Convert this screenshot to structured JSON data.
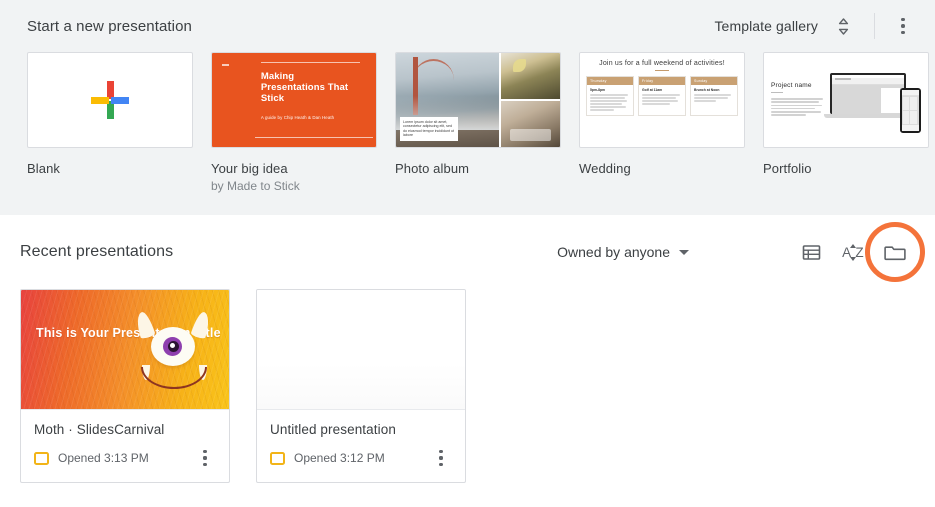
{
  "new_presentation": {
    "title": "Start a new presentation",
    "template_gallery_label": "Template gallery",
    "toggle_icon": "chevron-up-down-icon",
    "more_icon": "more-vert-icon",
    "templates": [
      {
        "label": "Blank",
        "sublabel": "",
        "thumb_kind": "blank-plus",
        "icon": "google-plus-icon"
      },
      {
        "label": "Your big idea",
        "sublabel": "by Made to Stick",
        "thumb_kind": "big-idea",
        "slide_title": "Making Presentations That Stick",
        "slide_byline": "A guide by Chip Heath & Dan Heath",
        "accent_color": "#e8541f"
      },
      {
        "label": "Photo album",
        "sublabel": "",
        "thumb_kind": "photo-album",
        "caption": "Lorem ipsum dolor sit amet, consectetur adipiscing elit, sed do eiusmod tempor incididunt ut labore"
      },
      {
        "label": "Wedding",
        "sublabel": "",
        "thumb_kind": "wedding",
        "slide_title": "Join us for a full weekend of activities!",
        "columns": [
          {
            "day": "Thursday",
            "heading": "5pm-8pm"
          },
          {
            "day": "Friday",
            "heading": "Golf at 11am"
          },
          {
            "day": "Sunday",
            "heading": "Brunch at Noon"
          }
        ],
        "accent_color": "#c9a173"
      },
      {
        "label": "Portfolio",
        "sublabel": "",
        "thumb_kind": "portfolio",
        "slide_title": "Project name"
      }
    ]
  },
  "recent": {
    "title": "Recent presentations",
    "owner_filter_label": "Owned by anyone",
    "owner_filter_icon": "caret-down-icon",
    "list_view_icon": "list-view-icon",
    "sort_icon": "sort-az-icon",
    "sort_icon_text_a": "A",
    "sort_icon_text_z": "Z",
    "folder_icon": "folder-icon",
    "highlight_color": "#f4733a",
    "documents": [
      {
        "title": "Moth · SlidesCarnival",
        "opened": "Opened 3:13 PM",
        "file_icon": "slides-file-icon",
        "more_icon": "more-vert-icon",
        "thumb_kind": "monster",
        "thumb_title": "This is Your Presentation Title"
      },
      {
        "title": "Untitled presentation",
        "opened": "Opened 3:12 PM",
        "file_icon": "slides-file-icon",
        "more_icon": "more-vert-icon",
        "thumb_kind": "blank",
        "thumb_title": ""
      }
    ]
  }
}
